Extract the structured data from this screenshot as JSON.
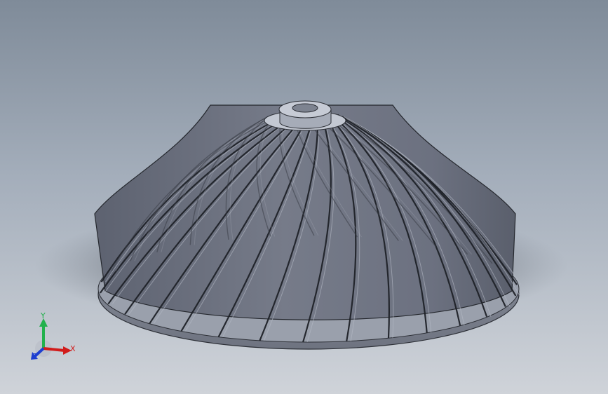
{
  "viewport": {
    "background_top": "#7f8b99",
    "background_bottom": "#cfd3d9"
  },
  "model": {
    "name": "impeller",
    "blade_count": 30,
    "blade_color": "#8a8f9b",
    "hub_color": "#b6bcc8"
  },
  "triad": {
    "x_label": "X",
    "y_label": "Y",
    "z_label": "Z",
    "x_color": "#d11c1c",
    "y_color": "#22b14c",
    "z_color": "#1e3fd0"
  }
}
